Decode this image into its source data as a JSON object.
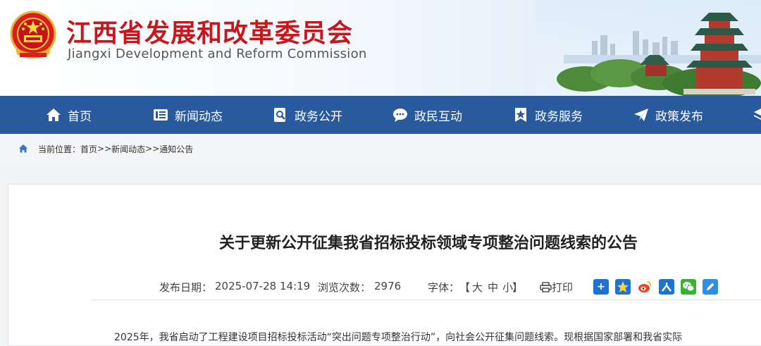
{
  "header": {
    "site_name_cn": "江西省发展和改革委员会",
    "site_name_en": "Jiangxi Development and Reform Commission"
  },
  "nav": {
    "items": [
      {
        "label": "首页",
        "icon": "home-icon"
      },
      {
        "label": "新闻动态",
        "icon": "news-icon"
      },
      {
        "label": "政务公开",
        "icon": "search-doc-icon"
      },
      {
        "label": "政民互动",
        "icon": "chat-icon"
      },
      {
        "label": "政务服务",
        "icon": "star-badge-icon"
      },
      {
        "label": "政策发布",
        "icon": "paper-plane-icon"
      }
    ]
  },
  "breadcrumb": {
    "prefix": "当前位置：",
    "items": [
      "首页",
      ">>",
      "新闻动态",
      ">>",
      "通知公告"
    ]
  },
  "article": {
    "title": "关于更新公开征集我省招标投标领域专项整治问题线索的公告",
    "publish_label": "发布日期：",
    "publish_date": "2025-07-28 14:19",
    "views_label": "浏览次数：",
    "views": "2976",
    "font_label": "字体：",
    "font_open": "【",
    "font_large": "大",
    "font_medium": "中",
    "font_small": "小",
    "font_close": "】",
    "print_label": "打印",
    "share_icons": [
      "share-plus-icon",
      "qzone-icon",
      "weibo-icon",
      "people-icon",
      "wechat-icon",
      "edit-icon"
    ],
    "body_first_line": "2025年，我省启动了工程建设项目招标投标活动“突出问题专项整治行动”，向社会公开征集问题线索。现根据国家部署和我省实际"
  },
  "colors": {
    "nav_bg": "#2a5a9e",
    "site_name": "#c8161d",
    "share_blue": "#1e73d2",
    "share_red": "#e6462d"
  }
}
